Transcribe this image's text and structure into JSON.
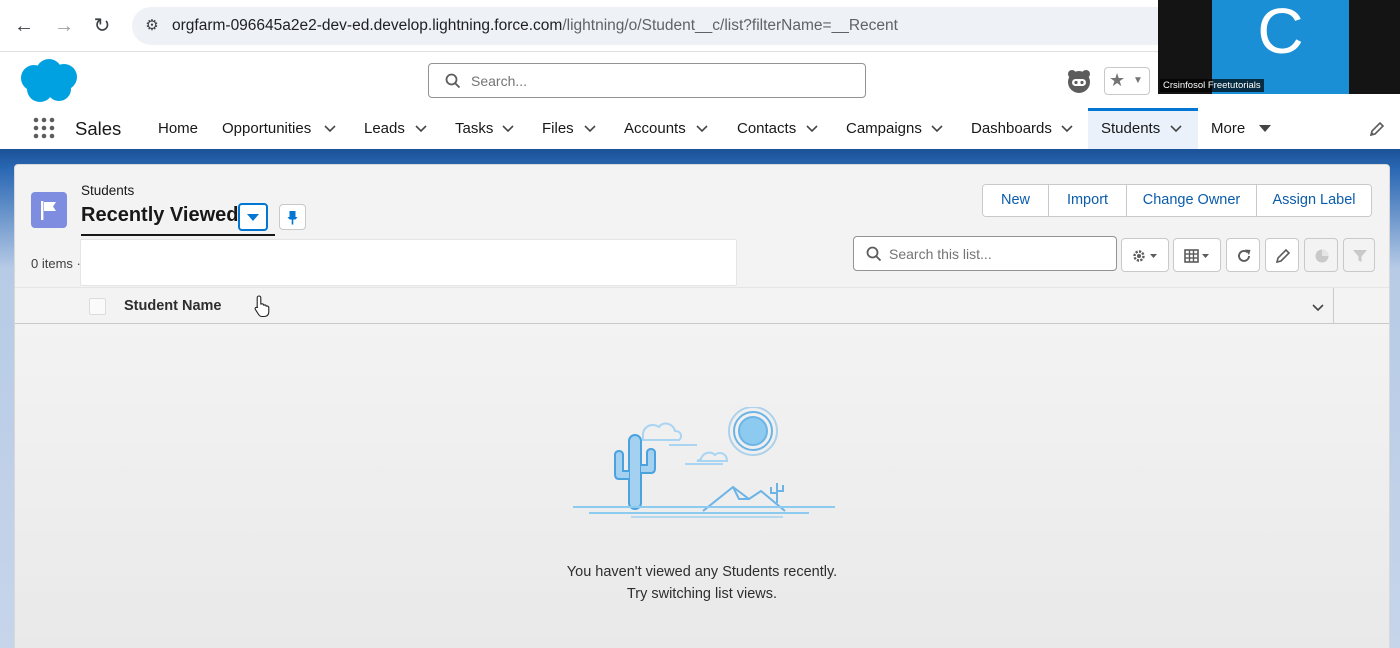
{
  "browser": {
    "url_main": "orgfarm-096645a2e2-dev-ed.develop.lightning.force.com",
    "url_path": "/lightning/o/Student__c/list?filterName=__Recent"
  },
  "webcam": {
    "letter": "C",
    "name": "Crsinfosol Freetutorials"
  },
  "header": {
    "search_placeholder": "Search..."
  },
  "nav": {
    "app_name": "Sales",
    "items": [
      {
        "label": "Home"
      },
      {
        "label": "Opportunities"
      },
      {
        "label": "Leads"
      },
      {
        "label": "Tasks"
      },
      {
        "label": "Files"
      },
      {
        "label": "Accounts"
      },
      {
        "label": "Contacts"
      },
      {
        "label": "Campaigns"
      },
      {
        "label": "Dashboards"
      },
      {
        "label": "Students"
      },
      {
        "label": "More"
      }
    ],
    "active": "Students"
  },
  "list": {
    "object_label": "Students",
    "view_name": "Recently Viewed",
    "item_count": "0 items ·",
    "search_placeholder": "Search this list...",
    "actions": [
      "New",
      "Import",
      "Change Owner",
      "Assign Label"
    ],
    "columns": [
      "Student Name"
    ],
    "empty_line1": "You haven't viewed any Students recently.",
    "empty_line2": "Try switching list views."
  },
  "colors": {
    "brand_blue": "#0176d3",
    "link_blue": "#0b5cab",
    "object_icon": "#7f8de1",
    "band_blue": "#1b5297",
    "illustration": "#4aa3df"
  }
}
